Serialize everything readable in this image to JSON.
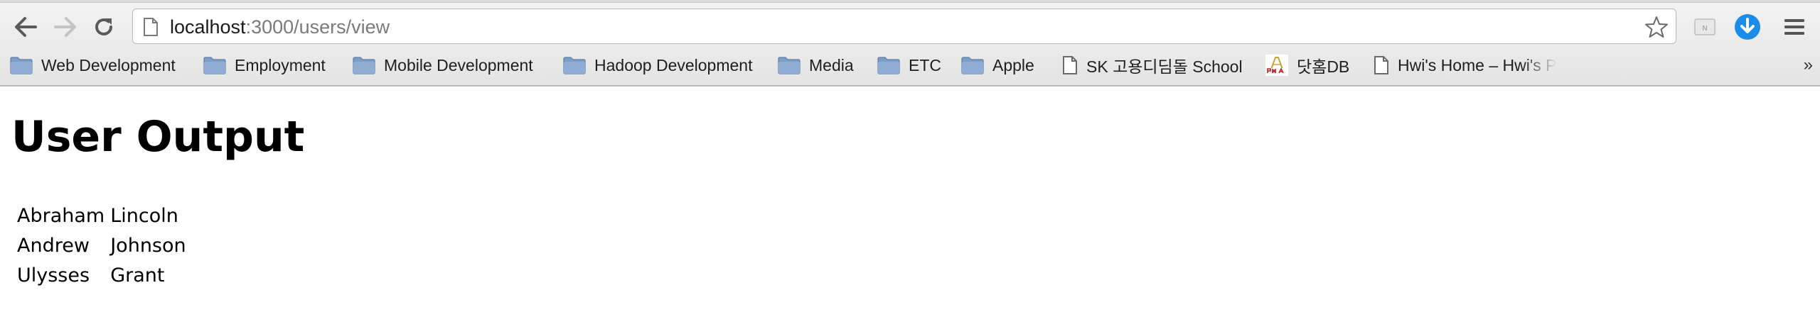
{
  "browser": {
    "url_host": "localhost",
    "url_path": ":3000/users/view",
    "bookmarks": [
      {
        "label": "Web Development",
        "icon": "folder-icon"
      },
      {
        "label": "Employment",
        "icon": "folder-icon"
      },
      {
        "label": "Mobile Development",
        "icon": "folder-icon"
      },
      {
        "label": "Hadoop Development",
        "icon": "folder-icon"
      },
      {
        "label": "Media",
        "icon": "folder-icon"
      },
      {
        "label": "ETC",
        "icon": "folder-icon"
      },
      {
        "label": "Apple",
        "icon": "folder-icon"
      },
      {
        "label": "SK 고용디딤돌 School",
        "icon": "page-icon"
      },
      {
        "label": "닷홈DB",
        "icon": "site-favicon"
      },
      {
        "label": "Hwi's Home – Hwi's P",
        "icon": "page-icon"
      }
    ],
    "overflow_label": "»",
    "extension_badge": "N"
  },
  "page": {
    "title": "User Output",
    "users": [
      {
        "first": "Abraham",
        "last": "Lincoln"
      },
      {
        "first": "Andrew",
        "last": "Johnson"
      },
      {
        "first": "Ulysses",
        "last": "Grant"
      }
    ]
  },
  "colors": {
    "folder": "#6f8fb8",
    "download_blue": "#1a8de8"
  }
}
